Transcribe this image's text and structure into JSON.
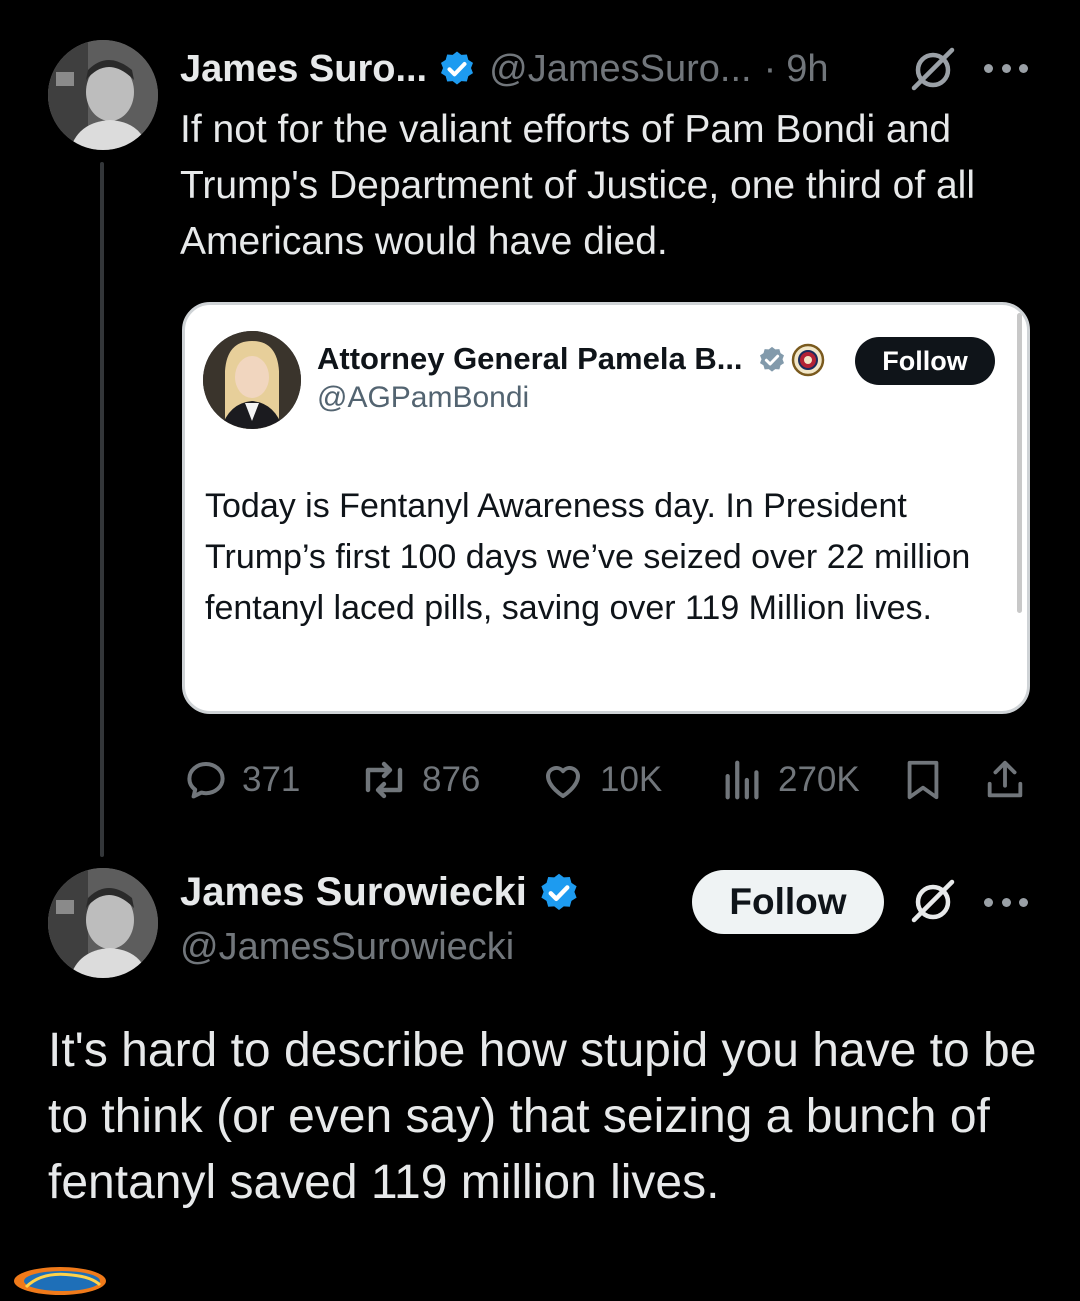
{
  "colors": {
    "background": "#000000",
    "text": "#e7e9ea",
    "muted": "#71767b",
    "verified": "#1d9bf0",
    "quote_background": "#ffffff"
  },
  "reply_tweet": {
    "author_name": "James Suro...",
    "author_handle": "@JamesSuro...",
    "separator": "·",
    "time": "9h",
    "text": "If not for the valiant efforts of Pam Bondi and Trump's Department of Justice, one third of all Americans would have died."
  },
  "quoted_tweet": {
    "author_name": "Attorney General Pamela B...",
    "author_handle": "@AGPamBondi",
    "follow_label": "Follow",
    "text": "Today is Fentanyl Awareness day. In President Trump’s first 100 days we’ve seized over 22 million fentanyl laced pills, saving over 119 Million lives."
  },
  "actions": {
    "replies": "371",
    "reposts": "876",
    "likes": "10K",
    "views": "270K"
  },
  "main_tweet": {
    "author_name": "James Surowiecki",
    "author_handle": "@JamesSurowiecki",
    "follow_label": "Follow",
    "text": "It's hard to describe how stupid you have to be to think (or even say) that seizing a bunch of fentanyl saved 119 million lives."
  },
  "icons": {
    "verified": "verified-badge-icon",
    "grok": "grok-icon",
    "more": "more-icon",
    "reply": "reply-icon",
    "repost": "repost-icon",
    "like": "like-icon",
    "views": "views-icon",
    "bookmark": "bookmark-icon",
    "share": "share-icon"
  }
}
